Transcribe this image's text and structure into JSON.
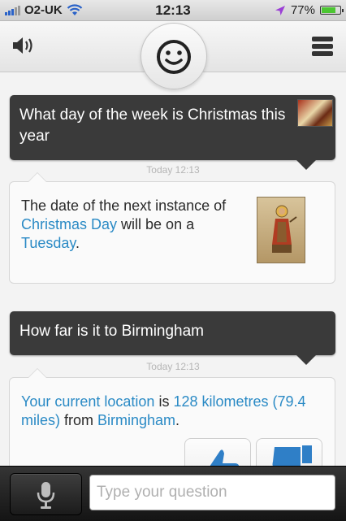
{
  "status_bar": {
    "carrier": "O2-UK",
    "time": "12:13",
    "battery_percent": "77%",
    "battery_level": 0.77,
    "colors": {
      "signal": "#2a62c8",
      "location_arrow": "#9b3fd6",
      "battery": "#4cc632"
    }
  },
  "toolbar": {
    "speaker_icon": "speaker-icon",
    "logo_icon": "smiley-face-icon",
    "menu_icon": "list-menu-icon"
  },
  "conversation": [
    {
      "question": "What day of the week is Christmas this year",
      "timestamp": "Today 12:13",
      "answer": {
        "part1": "The date of the next instance of ",
        "link1": "Christmas Day",
        "part2": " will be on a ",
        "link2": "Tuesday",
        "part3": "."
      }
    },
    {
      "question": "How far is it to Birmingham",
      "timestamp": "Today 12:13",
      "answer": {
        "link1": "Your current location",
        "part1": " is ",
        "link2": "128 kilometres (79.4 miles)",
        "part2": " from ",
        "link3": "Birmingham",
        "part3": "."
      }
    }
  ],
  "input_bar": {
    "mic_icon": "microphone-icon",
    "placeholder": "Type your question"
  },
  "colors": {
    "link": "#2a8ac5",
    "question_bubble": "#3a3a3a",
    "thumb_icon": "#2f7fc7"
  }
}
